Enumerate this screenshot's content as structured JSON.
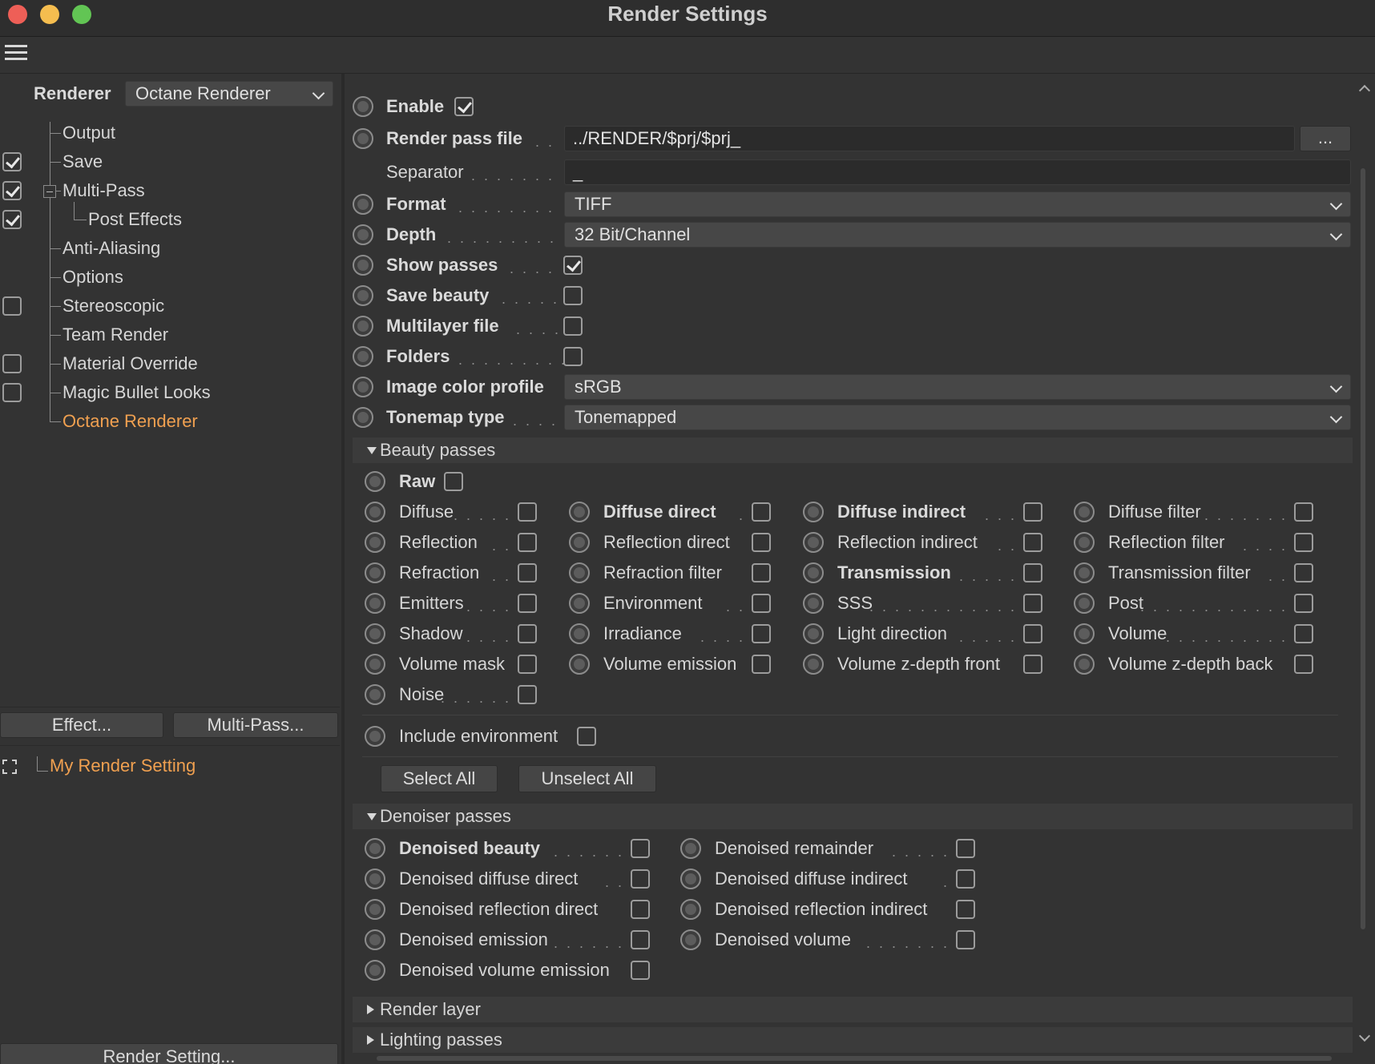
{
  "window": {
    "title": "Render Settings"
  },
  "left": {
    "renderer_label": "Renderer",
    "renderer_value": "Octane Renderer",
    "tree": [
      {
        "label": "Output",
        "check": null
      },
      {
        "label": "Save",
        "check": true
      },
      {
        "label": "Multi-Pass",
        "check": true
      },
      {
        "label": "Post Effects",
        "check": true
      },
      {
        "label": "Anti-Aliasing",
        "check": null
      },
      {
        "label": "Options",
        "check": null
      },
      {
        "label": "Stereoscopic",
        "check": false
      },
      {
        "label": "Team Render",
        "check": null
      },
      {
        "label": "Material Override",
        "check": false
      },
      {
        "label": "Magic Bullet Looks",
        "check": false
      },
      {
        "label": "Octane Renderer",
        "check": null
      }
    ],
    "effect_button": "Effect...",
    "multipass_button": "Multi-Pass...",
    "setting_name": "My Render Setting",
    "render_setting_button": "Render Setting...",
    "accent": "#f0a050"
  },
  "render_passes": {
    "enable_label": "Enable",
    "enable_checked": true,
    "pass_file_label": "Render pass file",
    "pass_file_value": "../RENDER/$prj/$prj_",
    "browse_label": "...",
    "separator_label": "Separator",
    "separator_value": "_",
    "format_label": "Format",
    "format_value": "TIFF",
    "depth_label": "Depth",
    "depth_value": "32 Bit/Channel",
    "show_passes_label": "Show passes",
    "show_passes_checked": true,
    "save_beauty_label": "Save beauty",
    "multilayer_label": "Multilayer file",
    "folders_label": "Folders",
    "color_profile_label": "Image color profile",
    "color_profile_value": "sRGB",
    "tonemap_label": "Tonemap type",
    "tonemap_value": "Tonemapped"
  },
  "beauty": {
    "header": "Beauty passes",
    "raw_label": "Raw",
    "columns": [
      [
        "Diffuse",
        "Reflection",
        "Refraction",
        "Emitters",
        "Shadow",
        "Volume mask",
        "Noise"
      ],
      [
        "Diffuse direct",
        "Reflection direct",
        "Refraction filter",
        "Environment",
        "Irradiance",
        "Volume emission"
      ],
      [
        "Diffuse indirect",
        "Reflection indirect",
        "Transmission",
        "SSS",
        "Light direction",
        "Volume z-depth front"
      ],
      [
        "Diffuse filter",
        "Reflection filter",
        "Transmission filter",
        "Post",
        "Volume",
        "Volume z-depth back"
      ]
    ],
    "include_env_label": "Include environment",
    "select_all": "Select All",
    "unselect_all": "Unselect All"
  },
  "denoiser": {
    "header": "Denoiser passes",
    "col1": [
      "Denoised beauty",
      "Denoised diffuse direct",
      "Denoised reflection direct",
      "Denoised emission",
      "Denoised volume emission"
    ],
    "col2": [
      "Denoised remainder",
      "Denoised diffuse indirect",
      "Denoised reflection indirect",
      "Denoised volume"
    ]
  },
  "collapsed": {
    "render_layer": "Render layer",
    "lighting_passes": "Lighting passes"
  }
}
